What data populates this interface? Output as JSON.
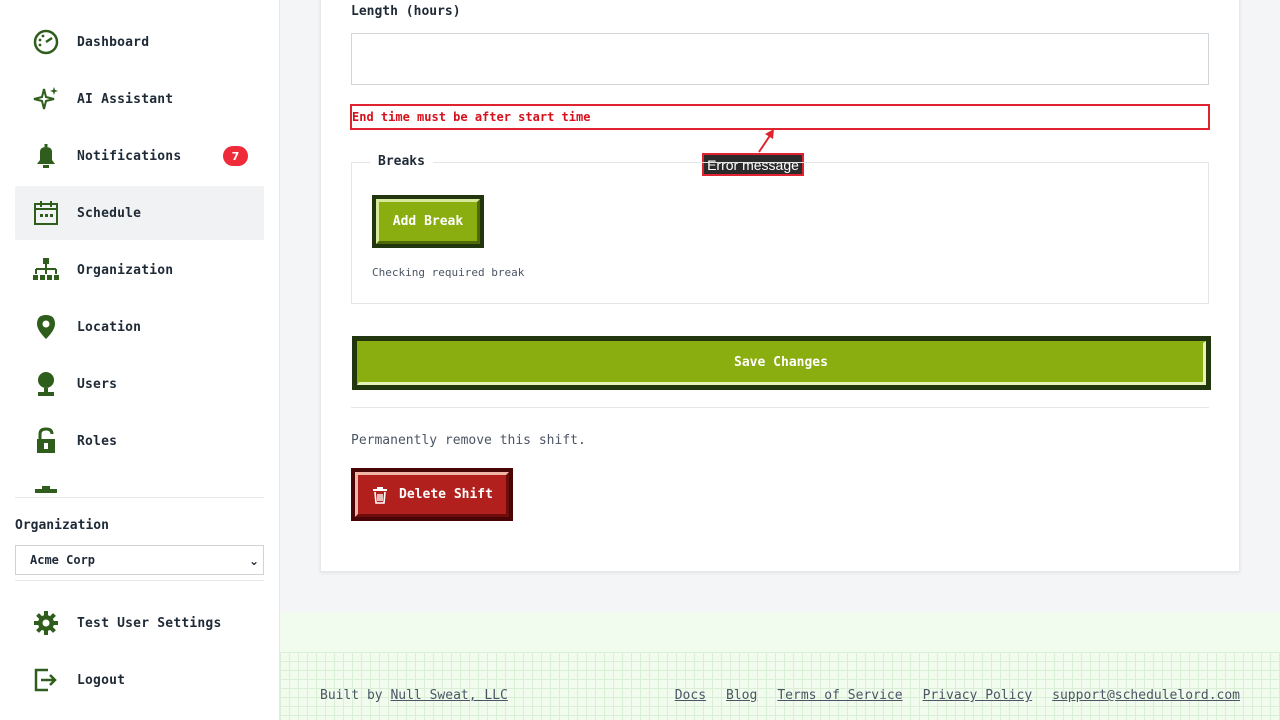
{
  "sidebar": {
    "items": [
      {
        "label": "Dashboard",
        "icon": "dashboard-icon"
      },
      {
        "label": "AI Assistant",
        "icon": "sparkle-icon"
      },
      {
        "label": "Notifications",
        "icon": "bell-icon",
        "badge": "7"
      },
      {
        "label": "Schedule",
        "icon": "calendar-icon",
        "active": true
      },
      {
        "label": "Organization",
        "icon": "org-chart-icon"
      },
      {
        "label": "Location",
        "icon": "location-pin-icon"
      },
      {
        "label": "Users",
        "icon": "user-icon"
      },
      {
        "label": "Roles",
        "icon": "lock-icon"
      }
    ],
    "org_title": "Organization",
    "org_selected": "Acme Corp",
    "bottom": [
      {
        "label": "Test User Settings",
        "icon": "gear-icon"
      },
      {
        "label": "Logout",
        "icon": "logout-icon"
      }
    ]
  },
  "form": {
    "length_label": "Length (hours)",
    "length_value": "",
    "error_text": "End time must be after start time",
    "error_tooltip": "Error message",
    "breaks_title": "Breaks",
    "add_break_label": "Add Break",
    "breaks_note": "Checking required break",
    "save_label": "Save Changes",
    "danger_text": "Permanently remove this shift.",
    "delete_label": "Delete Shift"
  },
  "footer": {
    "built_prefix": "Built by ",
    "company": "Null Sweat, LLC",
    "links": [
      "Docs",
      "Blog",
      "Terms of Service",
      "Privacy Policy",
      "support@schedulelord.com"
    ]
  },
  "colors": {
    "accent_green": "#8aad0f",
    "dark_green": "#21360e",
    "danger_red": "#b1201c",
    "error_red": "#e0242f",
    "icon_green": "#2f5d1b",
    "badge_red": "#ef2b3a"
  }
}
